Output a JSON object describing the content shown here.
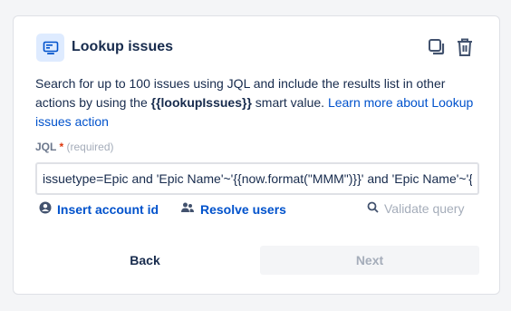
{
  "header": {
    "title": "Lookup issues",
    "icon": "monitor-icon",
    "actions": [
      "copy-icon",
      "trash-icon"
    ]
  },
  "description": {
    "prefix": "Search for up to 100 issues using JQL and include the results list in other actions by using the ",
    "smart_value": "{{lookupIssues}}",
    "middle": " smart value. ",
    "link": "Learn more about Lookup issues action"
  },
  "jql": {
    "label": "JQL",
    "required_marker": "*",
    "required_text": "(required)",
    "value": "issuetype=Epic and 'Epic Name'~'{{now.format(\"MMM\")}}' and 'Epic Name'~'{{now.format(\"YY\")}}'"
  },
  "helpers": {
    "insert_account": "Insert account id",
    "resolve_users": "Resolve users",
    "validate": "Validate query"
  },
  "footer": {
    "back": "Back",
    "next": "Next"
  },
  "colors": {
    "link": "#0052cc",
    "text": "#172b4d",
    "muted": "#a5adba",
    "required": "#de350b",
    "icon_bg": "#deebff"
  }
}
